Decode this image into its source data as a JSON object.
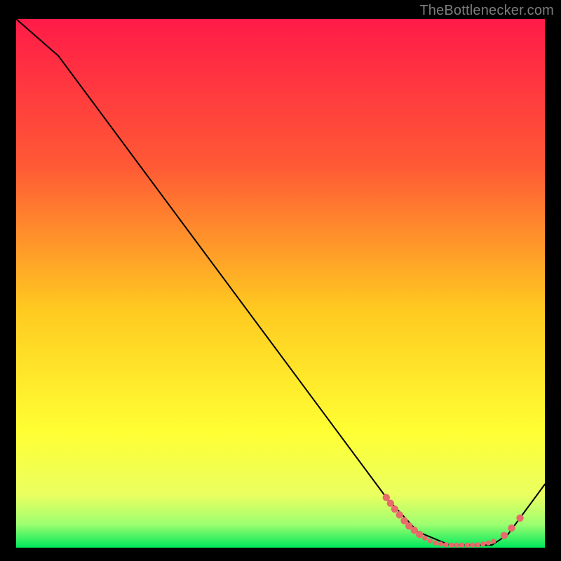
{
  "attribution": "TheBottlenecker.com",
  "chart_data": {
    "type": "line",
    "title": "",
    "xlabel": "",
    "ylabel": "",
    "xlim": [
      0,
      100
    ],
    "ylim": [
      0,
      100
    ],
    "gradient_stops": [
      {
        "offset": 0,
        "color": "#ff1b48"
      },
      {
        "offset": 0.28,
        "color": "#ff5a35"
      },
      {
        "offset": 0.55,
        "color": "#ffca20"
      },
      {
        "offset": 0.78,
        "color": "#ffff33"
      },
      {
        "offset": 0.9,
        "color": "#eaff60"
      },
      {
        "offset": 0.955,
        "color": "#9fff70"
      },
      {
        "offset": 1.0,
        "color": "#00e85c"
      }
    ],
    "series": [
      {
        "name": "curve",
        "stroke": "#000000",
        "stroke_width": 2,
        "x": [
          0,
          8,
          70,
          76,
          82,
          90,
          93,
          100
        ],
        "y": [
          100,
          93,
          9.5,
          3,
          0.5,
          0.5,
          2.5,
          12
        ]
      }
    ],
    "markers": {
      "name": "highlight-dots",
      "fill": "#e86a6a",
      "radius_main": 5.2,
      "radius_small": 3.6,
      "points": [
        {
          "x": 70.0,
          "y": 9.5,
          "r": "main"
        },
        {
          "x": 70.8,
          "y": 8.4,
          "r": "main"
        },
        {
          "x": 71.6,
          "y": 7.3,
          "r": "main"
        },
        {
          "x": 72.5,
          "y": 6.2,
          "r": "main"
        },
        {
          "x": 73.4,
          "y": 5.1,
          "r": "main"
        },
        {
          "x": 74.3,
          "y": 4.1,
          "r": "main"
        },
        {
          "x": 75.3,
          "y": 3.3,
          "r": "main"
        },
        {
          "x": 76.3,
          "y": 2.5,
          "r": "main"
        },
        {
          "x": 77.3,
          "y": 1.8,
          "r": "small"
        },
        {
          "x": 78.3,
          "y": 1.3,
          "r": "small"
        },
        {
          "x": 79.3,
          "y": 0.9,
          "r": "small"
        },
        {
          "x": 80.3,
          "y": 0.7,
          "r": "small"
        },
        {
          "x": 81.3,
          "y": 0.55,
          "r": "small"
        },
        {
          "x": 82.3,
          "y": 0.5,
          "r": "small"
        },
        {
          "x": 83.3,
          "y": 0.5,
          "r": "small"
        },
        {
          "x": 84.3,
          "y": 0.5,
          "r": "small"
        },
        {
          "x": 85.3,
          "y": 0.5,
          "r": "small"
        },
        {
          "x": 86.3,
          "y": 0.5,
          "r": "small"
        },
        {
          "x": 87.3,
          "y": 0.55,
          "r": "small"
        },
        {
          "x": 88.3,
          "y": 0.7,
          "r": "small"
        },
        {
          "x": 89.3,
          "y": 0.9,
          "r": "small"
        },
        {
          "x": 90.3,
          "y": 1.2,
          "r": "small"
        },
        {
          "x": 92.3,
          "y": 2.3,
          "r": "main"
        },
        {
          "x": 93.7,
          "y": 3.7,
          "r": "main"
        },
        {
          "x": 95.3,
          "y": 5.6,
          "r": "main"
        }
      ]
    }
  }
}
